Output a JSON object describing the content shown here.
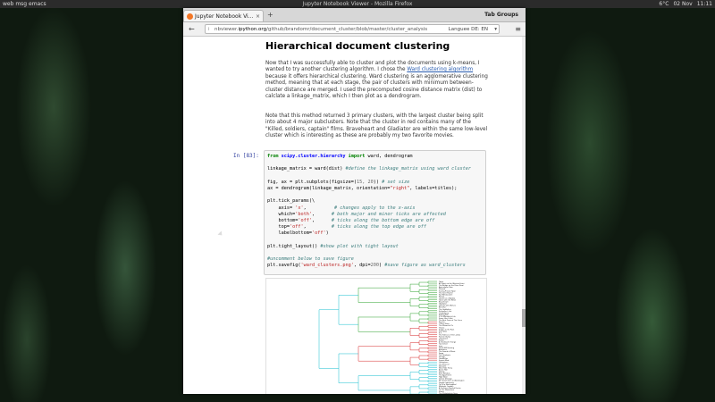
{
  "taskbar": {
    "left_text": "web  msg  emacs",
    "center_text": "Jupyter Notebook Viewer - Mozilla Firefox",
    "right_items": [
      "6°C",
      "02 Nov",
      "11:11"
    ]
  },
  "browser": {
    "tab_title": "Jupyter Notebook Vi...",
    "tab_close": "×",
    "new_tab": "+",
    "tab_groups": "Tab Groups",
    "url_prefix": "nbviewer.",
    "url_domain": "ipython.org",
    "url_rest": "/github/brandomr/document_cluster/blob/master/cluster_analysis",
    "lang": "Languee DE: EN",
    "back": "←",
    "info": "i",
    "dropdown": "▾",
    "menu": "≡"
  },
  "notebook": {
    "heading": "Hierarchical document clustering",
    "para1_before_link": "Now that I was successfully able to cluster and plot the documents using k-means, I wanted to try another clustering algorithm. I chose the ",
    "para1_link": "Ward clustering algorithm",
    "para1_after_link": " because it offers hierarchical clustering. Ward clustering is an agglomerative clustering method, meaning that at each stage, the pair of clusters with minimum between-cluster distance are merged. I used the precomputed cosine distance matrix (dist) to calclate a linkage_matrix, which I then plot as a dendrogram.",
    "para2": "Note that this method returned 3 primary clusters, with the largest cluster being split into about 4 major subclusters. Note that the cluster in red contains many of the \"Killed, soldiers, captain\" films. Braveheart and Gladiator are within the same low-level cluster which is interesting as these are probably my two favorite movies.",
    "prompt": "In [83]:",
    "code": {
      "l1_kw1": "from",
      "l1_mod": "scipy.cluster.hierarchy",
      "l1_kw2": "import",
      "l1_rest": " ward, dendrogram",
      "l2": "linkage_matrix = ward(dist) ",
      "l2_cm": "#define the linkage_matrix using ward cluster",
      "l3a": "fig, ax = plt.subplots(figsize=(",
      "l3n": "15, 20",
      "l3b": ")) ",
      "l3_cm": "# set size",
      "l4a": "ax = dendrogram(linkage_matrix, orientation=",
      "l4s": "\"right\"",
      "l4b": ", labels=titles);",
      "l5": "plt.tick_params(\\",
      "l6a": "    axis= ",
      "l6s": "'x'",
      "l6b": ",          ",
      "l6_cm": "# changes apply to the x-axis",
      "l7a": "    which=",
      "l7s": "'both'",
      "l7b": ",      ",
      "l7_cm": "# both major and minor ticks are affected",
      "l8a": "    bottom=",
      "l8s": "'off'",
      "l8b": ",      ",
      "l8_cm": "# ticks along the bottom edge are off",
      "l9a": "    top=",
      "l9s": "'off'",
      "l9b": ",         ",
      "l9_cm": "# ticks along the top edge are off",
      "l10a": "    labelbottom=",
      "l10s": "'off'",
      "l10b": ")",
      "l11a": "plt.tight_layout() ",
      "l11_cm": "#show plot with tight layout",
      "l12_cm": "#uncomment below to save figure",
      "l13a": "plt.savefig(",
      "l13s": "'ward_clusters.png'",
      "l13b": ", dpi=",
      "l13n": "200",
      "l13c": ") ",
      "l13_cm": "#save figure as ward_clusters"
    }
  },
  "dendrogram_labels": [
    "Tamo",
    "All Quiet on the Western Front",
    "The Bridge on the River Kwai",
    "Apocalypse Now",
    "Platoon",
    "Saving Private Ryan",
    "The Deer Hunter",
    "Full Metal Jacket",
    "Patton",
    "Lawrence of Arabia",
    "Gone with the Wind",
    "Braveheart",
    "Gladiator",
    "Dances with Wolves",
    "Ben-Hur",
    "The Godfather",
    "Schindler's List",
    "Casablanca",
    "Raging Bull",
    "It's a Wonderful Life",
    "Some Like It Hot",
    "The Best Years of Our Lives",
    "Psycho",
    "Citizen Kane",
    "The Wizard of Oz",
    "Titanic",
    "Singin' in the Rain",
    "Star Wars",
    "E.T.",
    "The Silence of the Lambs",
    "Forrest Gump",
    "Chinatown",
    "Rocky",
    "A Clockwork Orange",
    "Taxi Driver",
    "Jaws",
    "Good Will Hunting",
    "Amadeus",
    "The Sound of Music",
    "Fargo",
    "The Graduate",
    "Vertigo",
    "Goodfellas",
    "Sunset Blvd.",
    "Unforgiven",
    "The Exorcist",
    "Network",
    "West Side Story",
    "Annie Hall",
    "Tootsie",
    "Rear Window",
    "The Apartment",
    "High Noon",
    "Doctor Zhivago",
    "Mr. Smith Goes to Washington",
    "Double Indemnity",
    "To Kill a Mockingbird",
    "Midnight Cowboy",
    "A Streetcar Named Desire",
    "On the Waterfront",
    "Shane",
    "The Philadelphia Story",
    "Nashville",
    "Rebel Without a Cause"
  ]
}
